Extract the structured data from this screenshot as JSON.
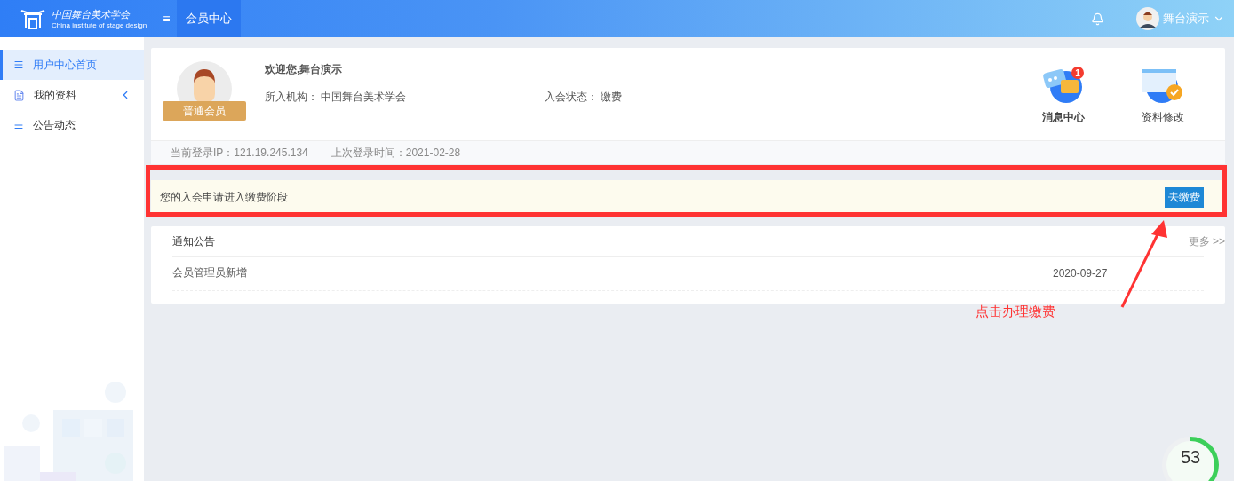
{
  "header": {
    "logo_text": "中国舞台美术学会",
    "logo_subtitle": "China institute of stage design",
    "menu_icon": "≡",
    "nav": [
      {
        "label": "会员中心",
        "selected": true
      }
    ],
    "user": "舞台演示"
  },
  "sidebar": {
    "items": [
      {
        "label": "用户中心首页",
        "selected": true,
        "kind": "list"
      },
      {
        "label": "我的资料",
        "selected": false,
        "kind": "doc",
        "expandable": true
      },
      {
        "label": "公告动态",
        "selected": false,
        "kind": "list"
      }
    ]
  },
  "profile": {
    "badge": "普通会员",
    "greeting": "欢迎您,舞台演示",
    "fields": [
      {
        "label": "所入机构：",
        "value": "中国舞台美术学会"
      },
      {
        "label": "入会状态：",
        "value": "缴费"
      }
    ],
    "shortcuts": [
      {
        "label": "消息中心",
        "kind": "message",
        "count": "1",
        "bold": true
      },
      {
        "label": "资料修改",
        "kind": "edit",
        "bold": false
      }
    ],
    "login_ip": "当前登录IP：121.19.245.134",
    "last_login": "上次登录时间：2021-02-28"
  },
  "notice_bar": {
    "text": "您的入会申请进入缴费阶段",
    "button": "去缴费"
  },
  "announcements": {
    "title": "通知公告",
    "more": "更多 >>",
    "rows": [
      {
        "title": "会员管理员新增",
        "date": "2020-09-27"
      }
    ]
  },
  "annotation": {
    "text": "点击办理缴费"
  },
  "progress": {
    "reading": "53"
  }
}
